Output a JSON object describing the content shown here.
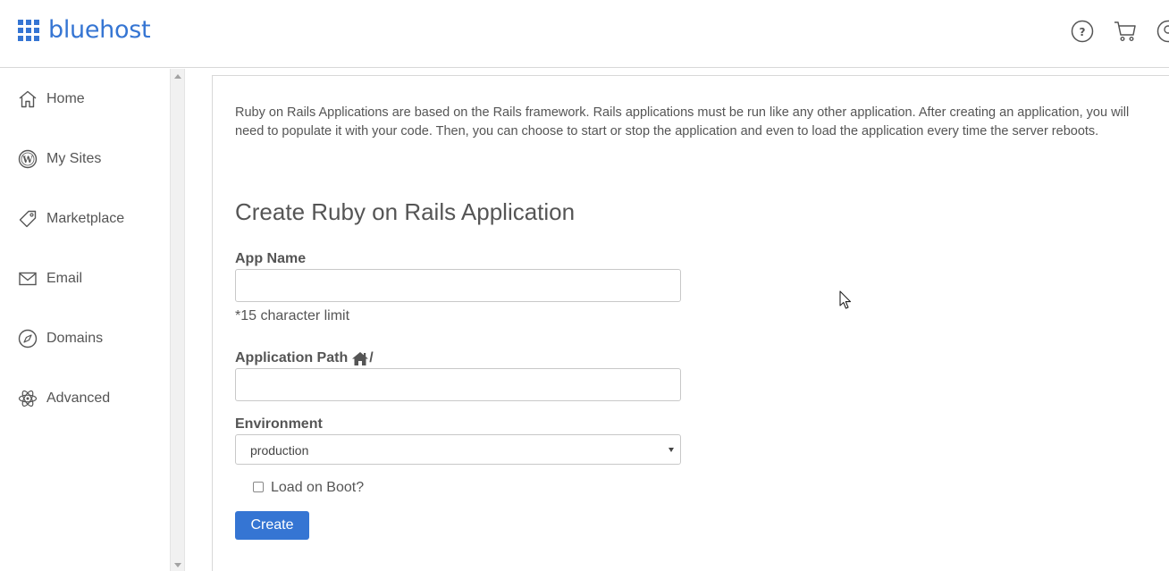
{
  "header": {
    "brand": "bluehost",
    "icons": [
      "help-icon",
      "cart-icon",
      "account-icon"
    ]
  },
  "sidebar": {
    "items": [
      {
        "label": "Home",
        "icon": "home-icon"
      },
      {
        "label": "My Sites",
        "icon": "wordpress-icon"
      },
      {
        "label": "Marketplace",
        "icon": "tag-icon"
      },
      {
        "label": "Email",
        "icon": "mail-icon"
      },
      {
        "label": "Domains",
        "icon": "compass-icon"
      },
      {
        "label": "Advanced",
        "icon": "atom-icon"
      }
    ]
  },
  "main": {
    "intro": "Ruby on Rails Applications are based on the Rails framework. Rails applications must be run like any other application. After creating an application, you will need to populate it with your code. Then, you can choose to start or stop the application and even to load the application every time the server reboots.",
    "title": "Create Ruby on Rails Application",
    "form": {
      "app_name_label": "App Name",
      "app_name_value": "",
      "app_name_hint": "*15 character limit",
      "app_path_label": "Application Path",
      "app_path_suffix": "/",
      "app_path_value": "",
      "environment_label": "Environment",
      "environment_value": "production",
      "load_on_boot_label": "Load on Boot?",
      "load_on_boot_checked": false,
      "create_label": "Create"
    }
  },
  "colors": {
    "brand": "#3575d3",
    "text": "#555555",
    "border": "#c8c8c8"
  }
}
